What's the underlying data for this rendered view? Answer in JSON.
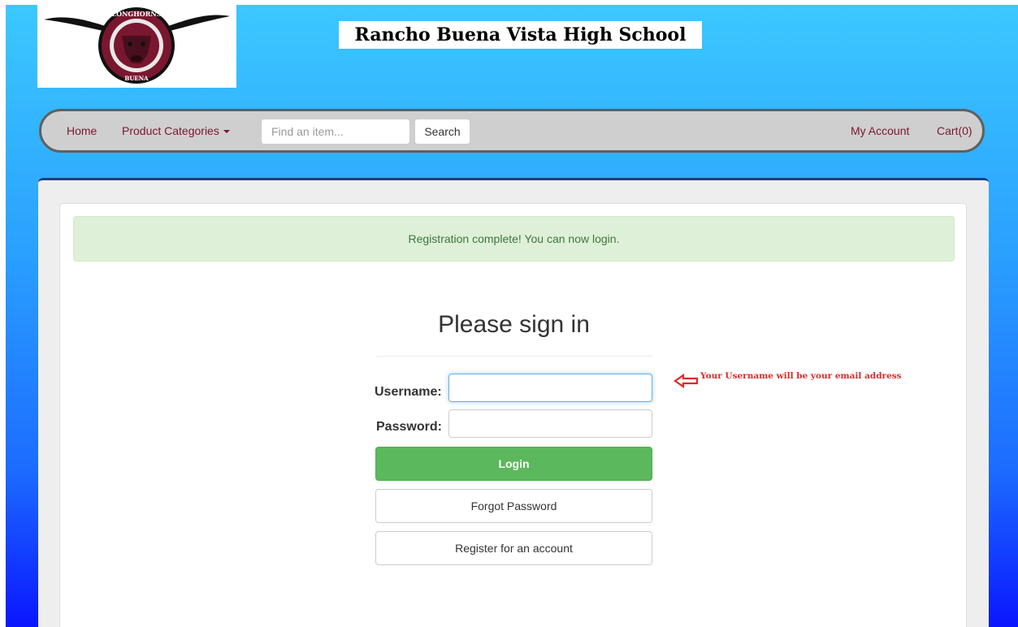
{
  "header": {
    "school_title": "Rancho Buena Vista High School",
    "logo": {
      "icon": "longhorn-logo",
      "top_text": "LONGHORNS",
      "bottom_text": "RANCHO BUENA VISTA",
      "colors": {
        "maroon": "#7a1730",
        "black": "#111111"
      }
    }
  },
  "nav": {
    "home": "Home",
    "product_categories": "Product Categories",
    "search": {
      "placeholder": "Find an item...",
      "button": "Search"
    },
    "my_account": "My Account",
    "cart": "Cart(0)",
    "link_color": "#7a1730"
  },
  "main": {
    "alert": "Registration complete! You can now login.",
    "heading": "Please sign in",
    "username_label": "Username:",
    "password_label": "Password:",
    "login_button": "Login",
    "forgot_button": "Forgot Password",
    "register_button": "Register for an account",
    "hint": "Your Username will be your email address"
  },
  "colors": {
    "success": "#5cb85c",
    "alert_bg": "#dff0d8",
    "alert_text": "#3c763d",
    "hint": "#e02828"
  }
}
